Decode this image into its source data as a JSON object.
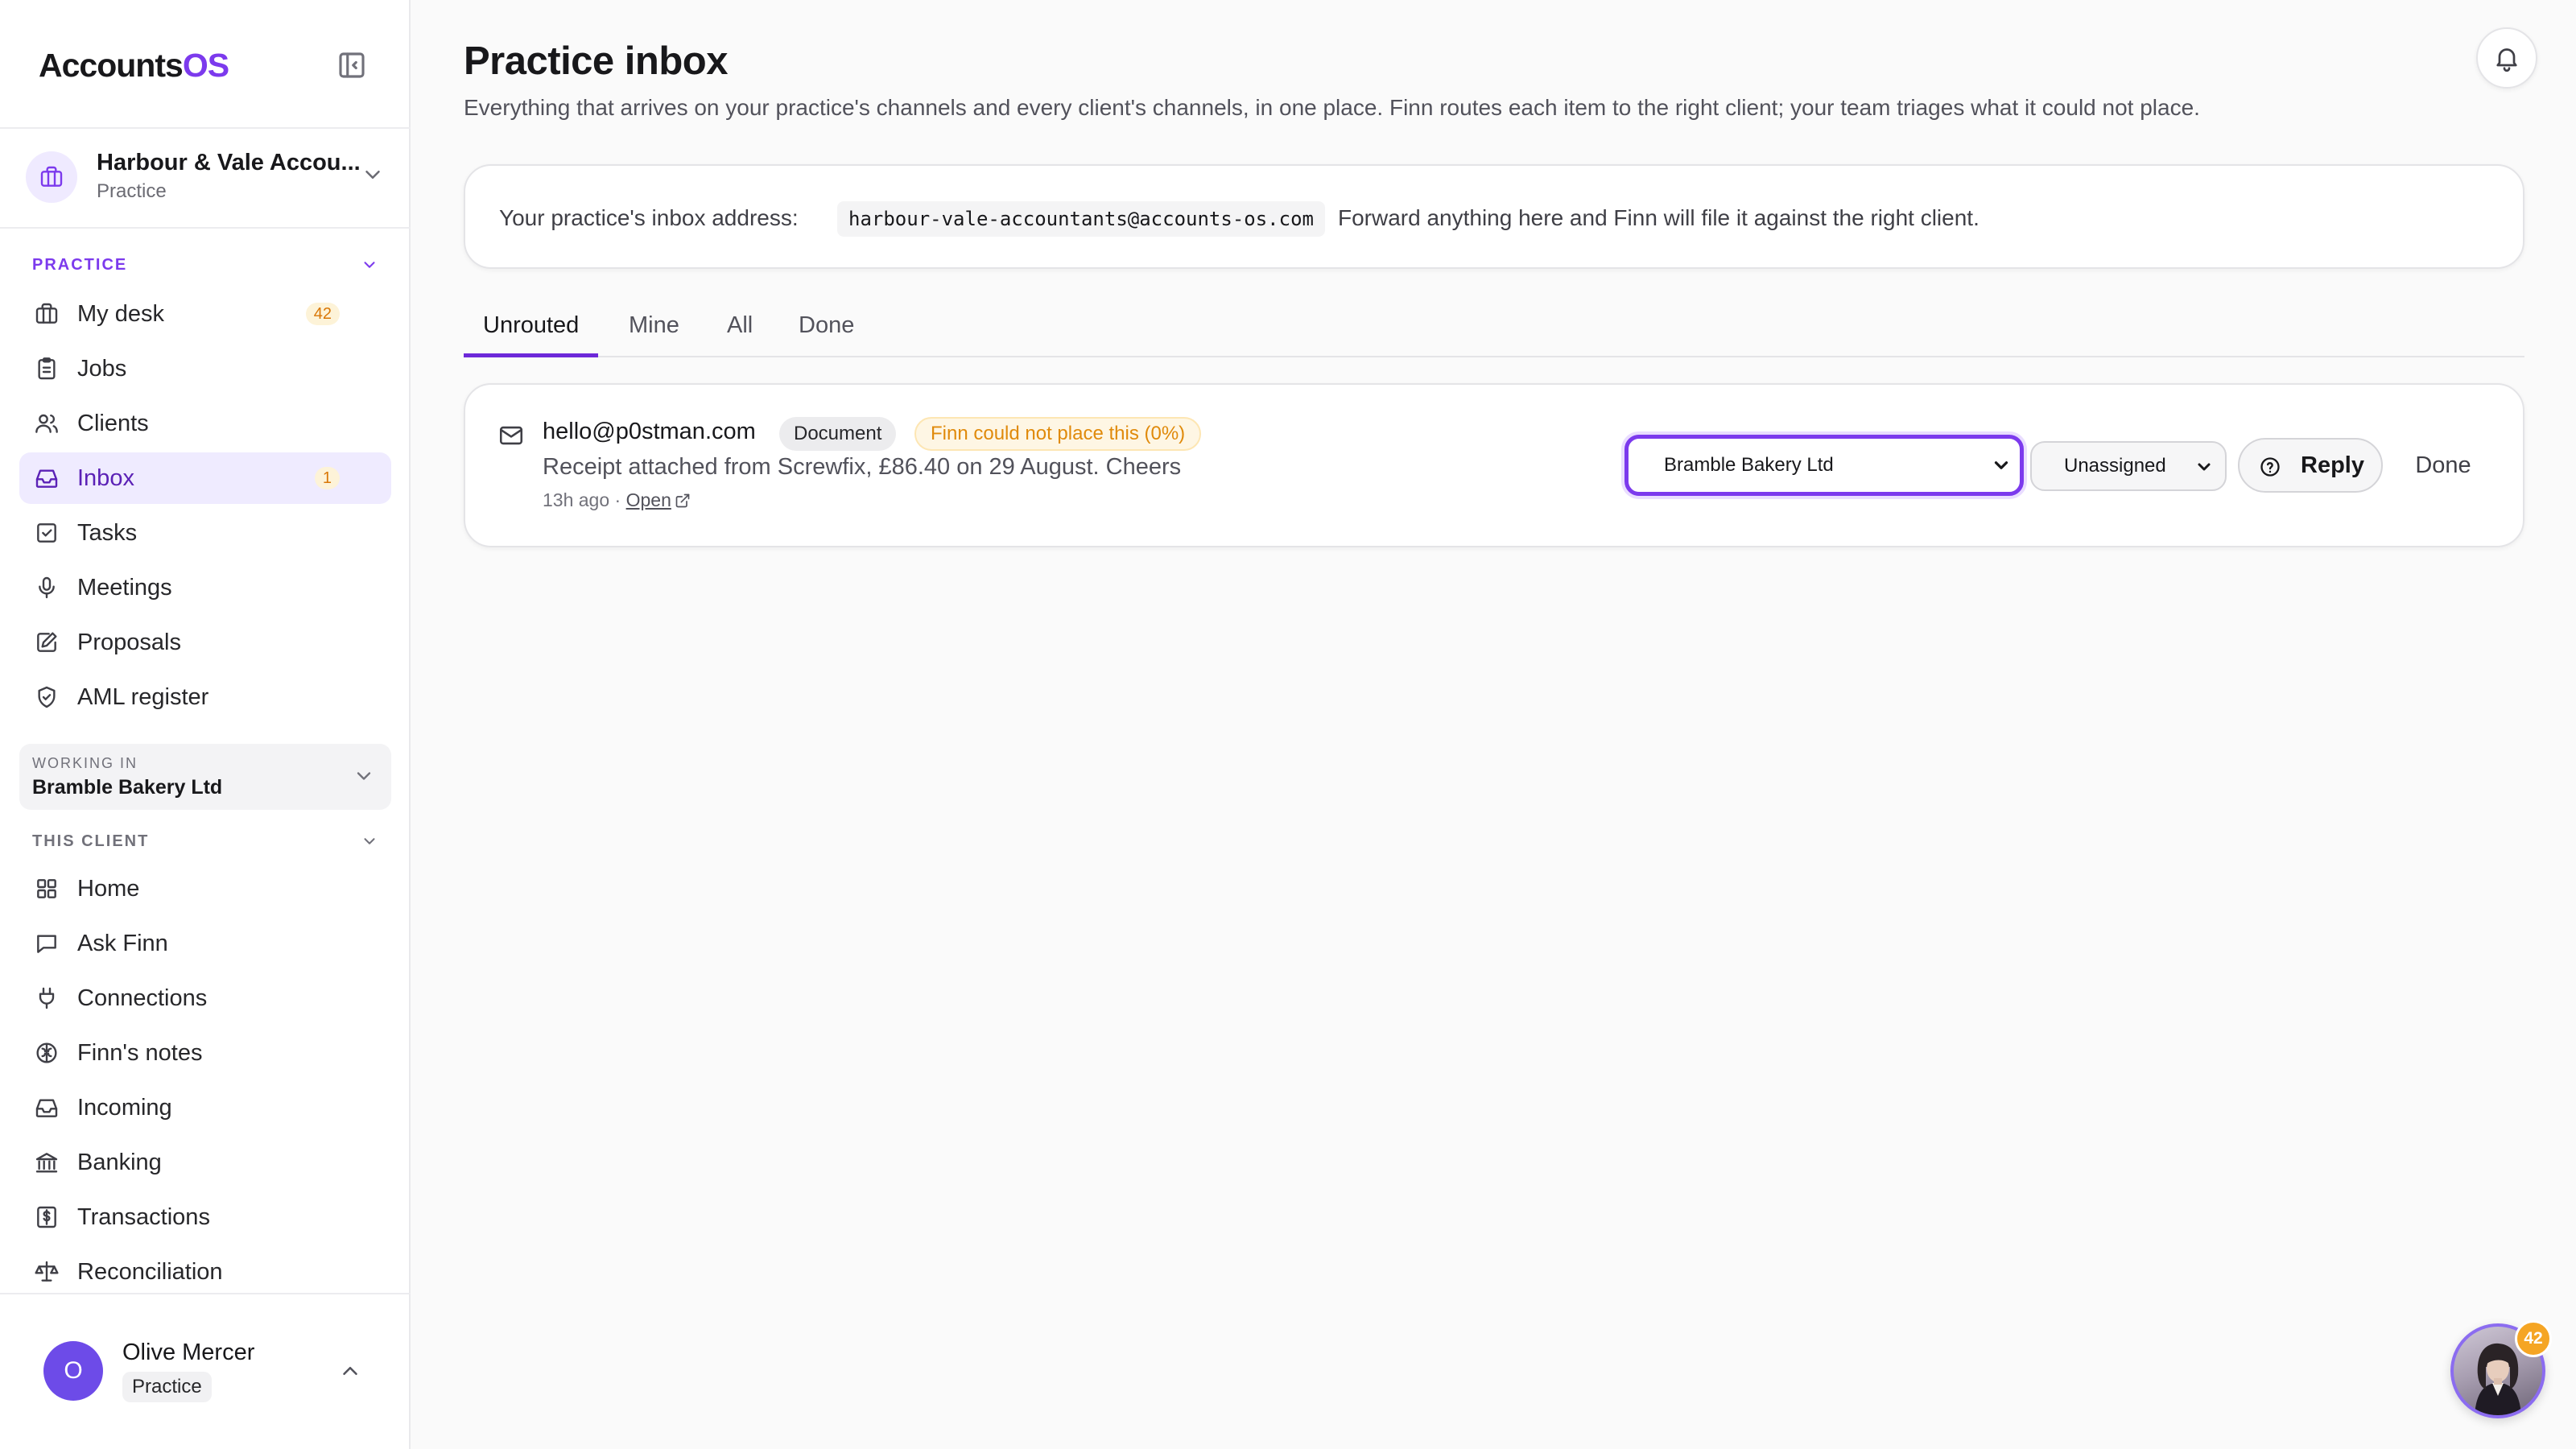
{
  "app": {
    "brand_main": "Accounts",
    "brand_accent": "OS",
    "accent_color": "#7c3aed"
  },
  "org": {
    "name": "Harbour & Vale Accou...",
    "type": "Practice"
  },
  "sidebar": {
    "practice_header": "PRACTICE",
    "practice_items": [
      {
        "label": "My desk",
        "icon": "briefcase-icon",
        "badge": "42"
      },
      {
        "label": "Jobs",
        "icon": "clipboard-icon"
      },
      {
        "label": "Clients",
        "icon": "users-icon"
      },
      {
        "label": "Inbox",
        "icon": "inbox-icon",
        "badge": "1",
        "active": true
      },
      {
        "label": "Tasks",
        "icon": "check-square-icon"
      },
      {
        "label": "Meetings",
        "icon": "mic-icon"
      },
      {
        "label": "Proposals",
        "icon": "edit-icon"
      },
      {
        "label": "AML register",
        "icon": "shield-check-icon"
      }
    ],
    "working_in_label": "WORKING IN",
    "working_in_value": "Bramble Bakery Ltd",
    "client_header": "THIS CLIENT",
    "client_items": [
      {
        "label": "Home",
        "icon": "grid-icon"
      },
      {
        "label": "Ask Finn",
        "icon": "message-square-icon"
      },
      {
        "label": "Connections",
        "icon": "plug-icon"
      },
      {
        "label": "Finn's notes",
        "icon": "brain-icon"
      },
      {
        "label": "Incoming",
        "icon": "inbox-icon"
      },
      {
        "label": "Banking",
        "icon": "bank-icon"
      },
      {
        "label": "Transactions",
        "icon": "receipt-icon"
      },
      {
        "label": "Reconciliation",
        "icon": "scale-icon"
      }
    ]
  },
  "user": {
    "initial": "O",
    "name": "Olive Mercer",
    "role": "Practice"
  },
  "page": {
    "title": "Practice inbox",
    "subtitle": "Everything that arrives on your practice's channels and every client's channels, in one place. Finn routes each item to the right client; your team triages what it could not place."
  },
  "address": {
    "prefix": "Your practice's inbox address:",
    "email": "harbour-vale-accountants@accounts-os.com",
    "suffix": "Forward anything here and Finn will file it against the right client."
  },
  "tabs": [
    "Unrouted",
    "Mine",
    "All",
    "Done"
  ],
  "active_tab": "Unrouted",
  "inbox_item": {
    "sender": "hello@p0stman.com",
    "type_badge": "Document",
    "status_badge": "Finn could not place this (0%)",
    "preview": "Receipt attached from Screwfix, £86.40 on 29 August. Cheers",
    "time": "13h ago",
    "separator": "·",
    "open_label": "Open",
    "client_select": "Bramble Bakery Ltd",
    "assignee_select": "Unassigned",
    "reply_label": "Reply",
    "done_label": "Done"
  },
  "assistant": {
    "badge": "42"
  }
}
